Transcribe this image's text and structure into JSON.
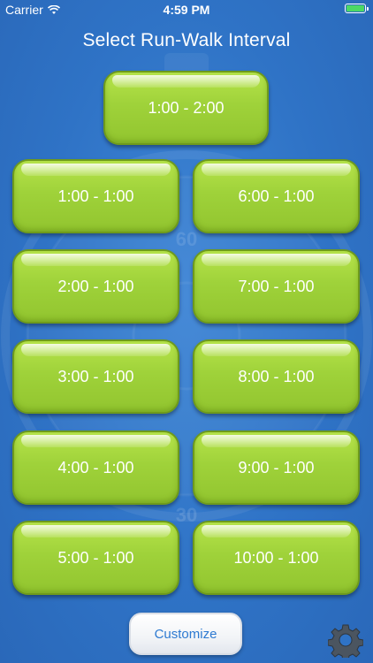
{
  "status_bar": {
    "carrier": "Carrier",
    "time": "4:59 PM",
    "battery_level": 1.0,
    "icons": [
      "wifi-icon",
      "battery-icon"
    ]
  },
  "title": "Select Run-Walk Interval",
  "intervals": [
    "1:00 - 2:00",
    "1:00 - 1:00",
    "6:00 - 1:00",
    "2:00 - 1:00",
    "7:00 - 1:00",
    "3:00 - 1:00",
    "8:00 - 1:00",
    "4:00 - 1:00",
    "9:00 - 1:00",
    "5:00 - 1:00",
    "10:00 - 1:00"
  ],
  "customize_label": "Customize",
  "settings_icon": "gear-icon",
  "colors": {
    "background": "#2f73c6",
    "button_green": "#9fd23a",
    "customize_text": "#2e7ad1",
    "battery_green": "#4cd964"
  }
}
